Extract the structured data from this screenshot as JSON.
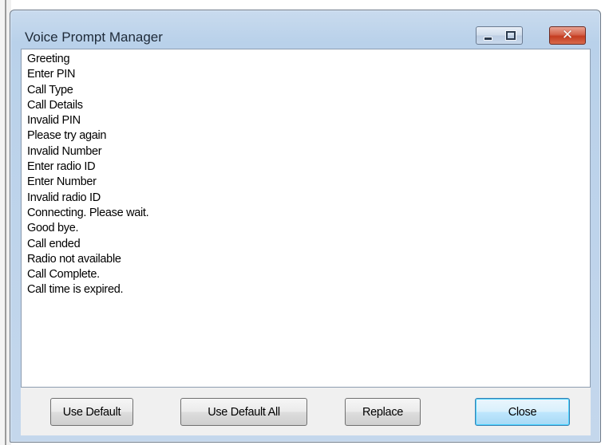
{
  "window": {
    "title": "Voice Prompt Manager",
    "controls": {
      "minimize": "minimize-icon",
      "maximize": "maximize-icon",
      "close": "close-icon"
    }
  },
  "prompts": [
    "Greeting",
    "Enter PIN",
    "Call Type",
    "Call Details",
    "Invalid PIN",
    "Please try again",
    "Invalid Number",
    "Enter radio ID",
    "Enter Number",
    "Invalid radio ID",
    "Connecting. Please wait.",
    "Good bye.",
    "Call ended",
    "Radio not available",
    "Call Complete.",
    "Call time is expired."
  ],
  "buttons": {
    "use_default": "Use Default",
    "use_default_all": "Use Default All",
    "replace": "Replace",
    "close": "Close"
  },
  "colors": {
    "titlebar": "#b9d1ea",
    "close_button": "#c43c20",
    "focused_button_border": "#3c7fb1"
  }
}
